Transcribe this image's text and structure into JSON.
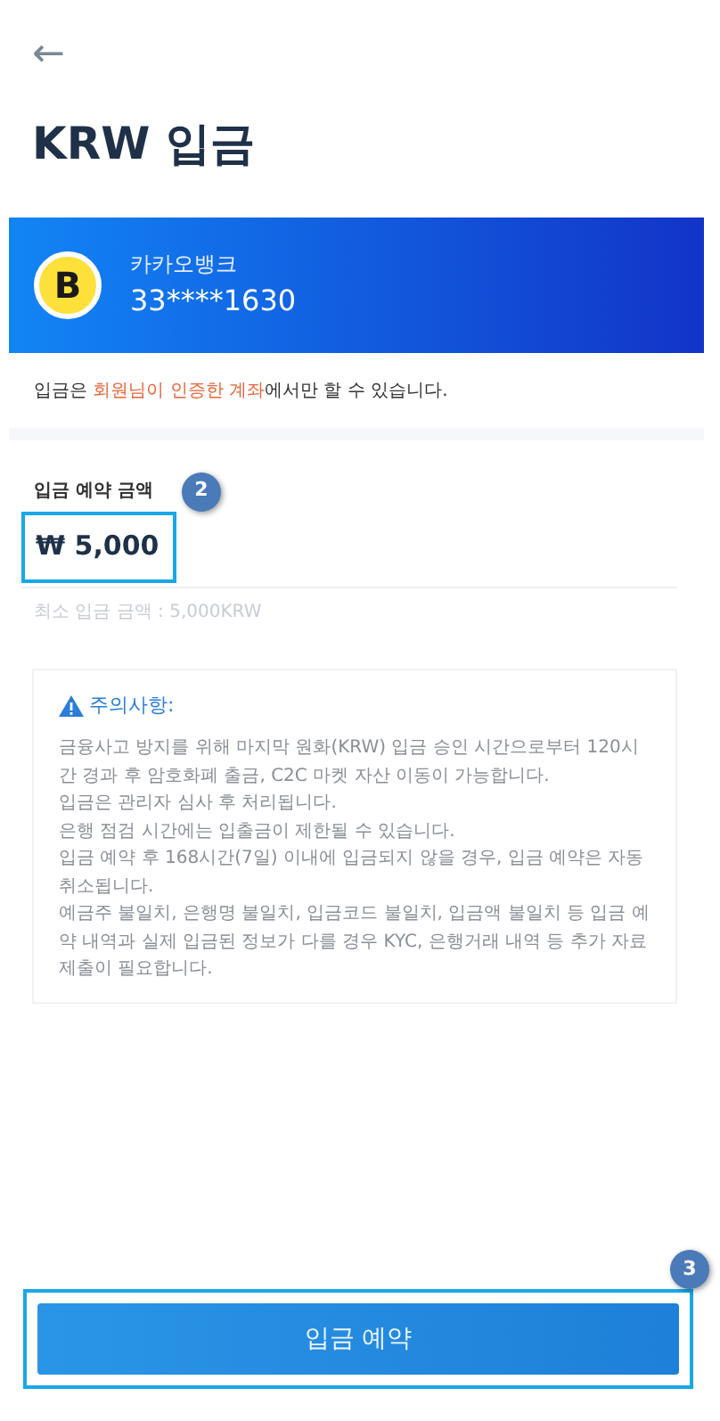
{
  "header": {
    "back": "←",
    "title": "KRW 입금"
  },
  "bank": {
    "logo": "B",
    "name": "카카오뱅크",
    "account": "33****1630"
  },
  "account_notice": [
    {
      "kind": "normal",
      "text": "입금은 "
    },
    {
      "kind": "highlight",
      "text": "회원님이 인증한 계좌"
    },
    {
      "kind": "normal",
      "text": "에서만 할 수 있습니다."
    }
  ],
  "amount": {
    "label": "입금 예약 금액",
    "value": "₩ 5,000",
    "step_badge": "2",
    "minimum": "최소 입금 금액 : 5,000KRW"
  },
  "caution": {
    "title": "주의사항:",
    "lines": [
      "금융사고 방지를 위해 마지막 원화(KRW) 입금 승인 시간으로부터 120시간 경과 후 암호화폐 출금, C2C 마켓 자산 이동이 가능합니다.",
      "입금은 관리자 심사 후 처리됩니다.",
      "은행 점검 시간에는 입출금이 제한될 수 있습니다.",
      "입금 예약 후 168시간(7일) 이내에 입금되지 않을 경우, 입금 예약은 자동 취소됩니다.",
      "예금주 불일치, 은행명 불일치, 입금코드 불일치, 입금액 불일치 등 입금 예약 내역과 실제 입금된 정보가 다를 경우 KYC, 은행거래 내역 등 추가 자료 제출이 필요합니다."
    ]
  },
  "submit": {
    "label": "입금 예약",
    "step_badge": "3"
  }
}
